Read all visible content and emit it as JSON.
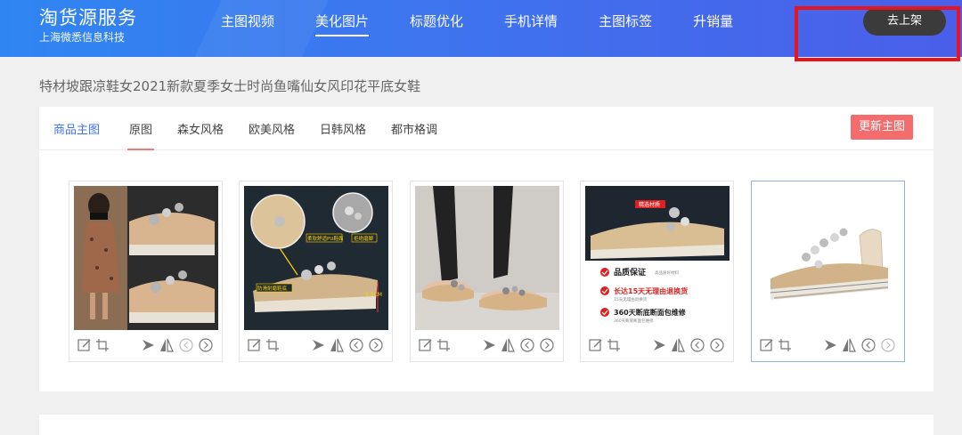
{
  "brand": {
    "title": "淘货源服务",
    "subtitle": "上海微悉信息科技"
  },
  "nav": {
    "items": [
      {
        "label": "主图视频",
        "active": false
      },
      {
        "label": "美化图片",
        "active": true
      },
      {
        "label": "标题优化",
        "active": false
      },
      {
        "label": "手机详情",
        "active": false
      },
      {
        "label": "主图标签",
        "active": false
      },
      {
        "label": "升销量",
        "active": false
      }
    ],
    "publish_label": "去上架"
  },
  "product": {
    "title": "特材坡跟凉鞋女2021新款夏季女士时尚鱼嘴仙女风印花平底女鞋"
  },
  "panel": {
    "section_label": "商品主图",
    "tabs": [
      "原图",
      "森女风格",
      "欧美风格",
      "日韩风格",
      "都市格调"
    ],
    "active_tab": "原图",
    "refresh_label": "更新主图"
  },
  "cards": [
    {
      "id": "card-1",
      "selected": false
    },
    {
      "id": "card-2",
      "selected": false,
      "overlay": {
        "label_a": "柔软舒适PU鞋面",
        "label_b": "拒绝磨脚",
        "label_c": "防滑耐磨鞋底",
        "height": "5.5CM"
      }
    },
    {
      "id": "card-3",
      "selected": false
    },
    {
      "id": "card-4",
      "selected": false,
      "overlay": {
        "badge": "精选材质",
        "rows": [
          {
            "strong": "品质保证",
            "sub": "高品质好材料"
          },
          {
            "strong": "长达15天无理由退换货",
            "sub": "15天无理由退换货"
          },
          {
            "strong": "360天断底断面包维修",
            "sub": "360天断底断面包维修"
          }
        ]
      }
    },
    {
      "id": "card-5",
      "selected": true
    }
  ],
  "colors": {
    "header_start": "#2f86f2",
    "header_end": "#4a5ee9",
    "accent": "#3e74ee",
    "refresh": "#f56c6c",
    "publish_bg": "#3b3b3b",
    "highlight": "#e8141b"
  },
  "icons": [
    "edit-icon",
    "crop-icon",
    "flip-horizontal-icon",
    "flip-vertical-icon",
    "rotate-left-icon",
    "rotate-right-icon"
  ]
}
